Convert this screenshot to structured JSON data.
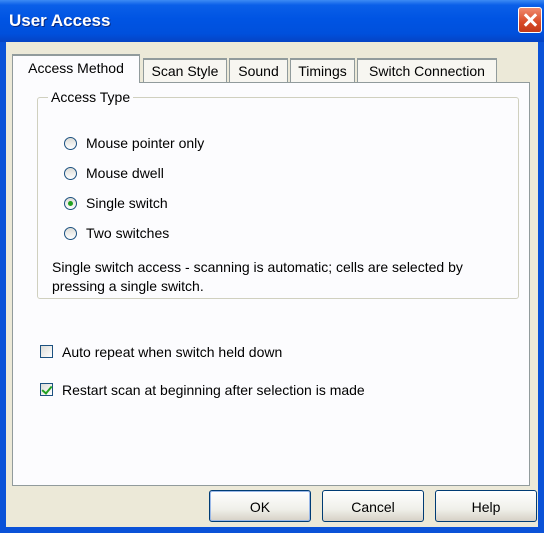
{
  "window": {
    "title": "User Access"
  },
  "tabs": [
    {
      "label": "Access Method",
      "active": true
    },
    {
      "label": "Scan Style",
      "active": false
    },
    {
      "label": "Sound",
      "active": false
    },
    {
      "label": "Timings",
      "active": false
    },
    {
      "label": "Switch Connection",
      "active": false
    }
  ],
  "access_type": {
    "group_label": "Access Type",
    "options": [
      {
        "label": "Mouse pointer only",
        "selected": false
      },
      {
        "label": "Mouse dwell",
        "selected": false
      },
      {
        "label": "Single switch",
        "selected": true
      },
      {
        "label": "Two switches",
        "selected": false
      }
    ],
    "description": "Single switch access - scanning is automatic; cells are selected by pressing a single switch."
  },
  "options": [
    {
      "label": "Auto repeat when switch held down",
      "checked": false
    },
    {
      "label": "Restart scan at beginning after selection is made",
      "checked": true
    }
  ],
  "buttons": {
    "ok": "OK",
    "cancel": "Cancel",
    "help": "Help"
  },
  "colors": {
    "titlebar": "#0054e3",
    "dialog_bg": "#ece9d8",
    "panel_bg": "#fcfcfe",
    "check_mark": "#21a121"
  }
}
